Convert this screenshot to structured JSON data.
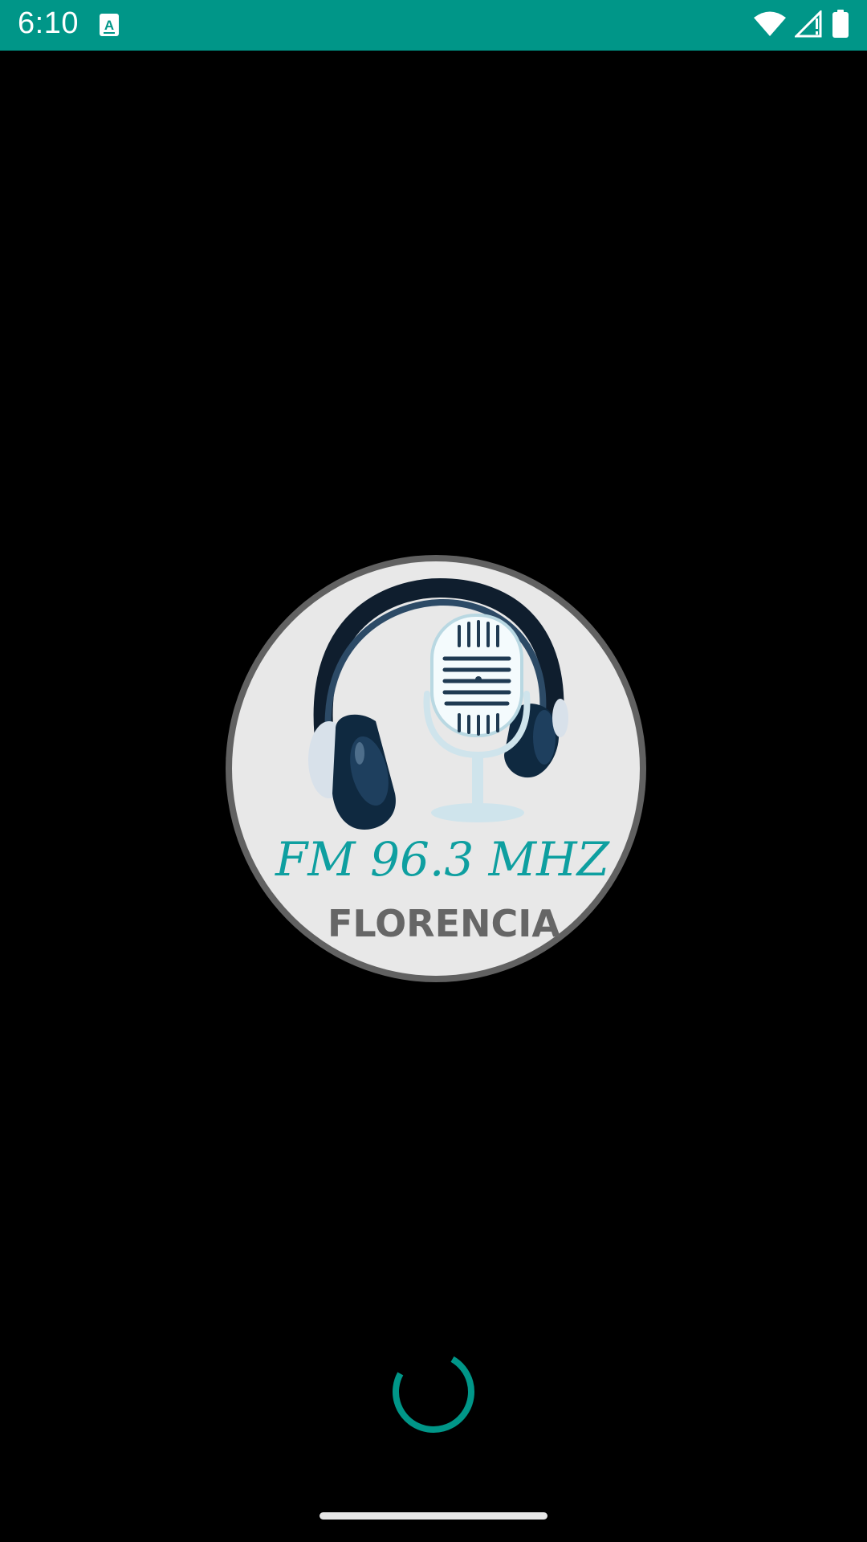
{
  "status_bar": {
    "time": "6:10",
    "background": "#009688",
    "icons": [
      "keyboard-a-icon",
      "wifi-icon",
      "cell-signal-icon",
      "battery-icon"
    ]
  },
  "logo": {
    "frequency": "FM 96.3 MHZ",
    "city": "FLORENCIA",
    "accent_color": "#0e9fa0",
    "ring_color": "#616161",
    "fill_color": "#e8e8e8",
    "graphic": [
      "headphones-icon",
      "microphone-icon"
    ]
  },
  "loading": {
    "indicator": "spinner",
    "color": "#009688"
  },
  "navigation": {
    "gesture_bar": "home-indicator"
  }
}
